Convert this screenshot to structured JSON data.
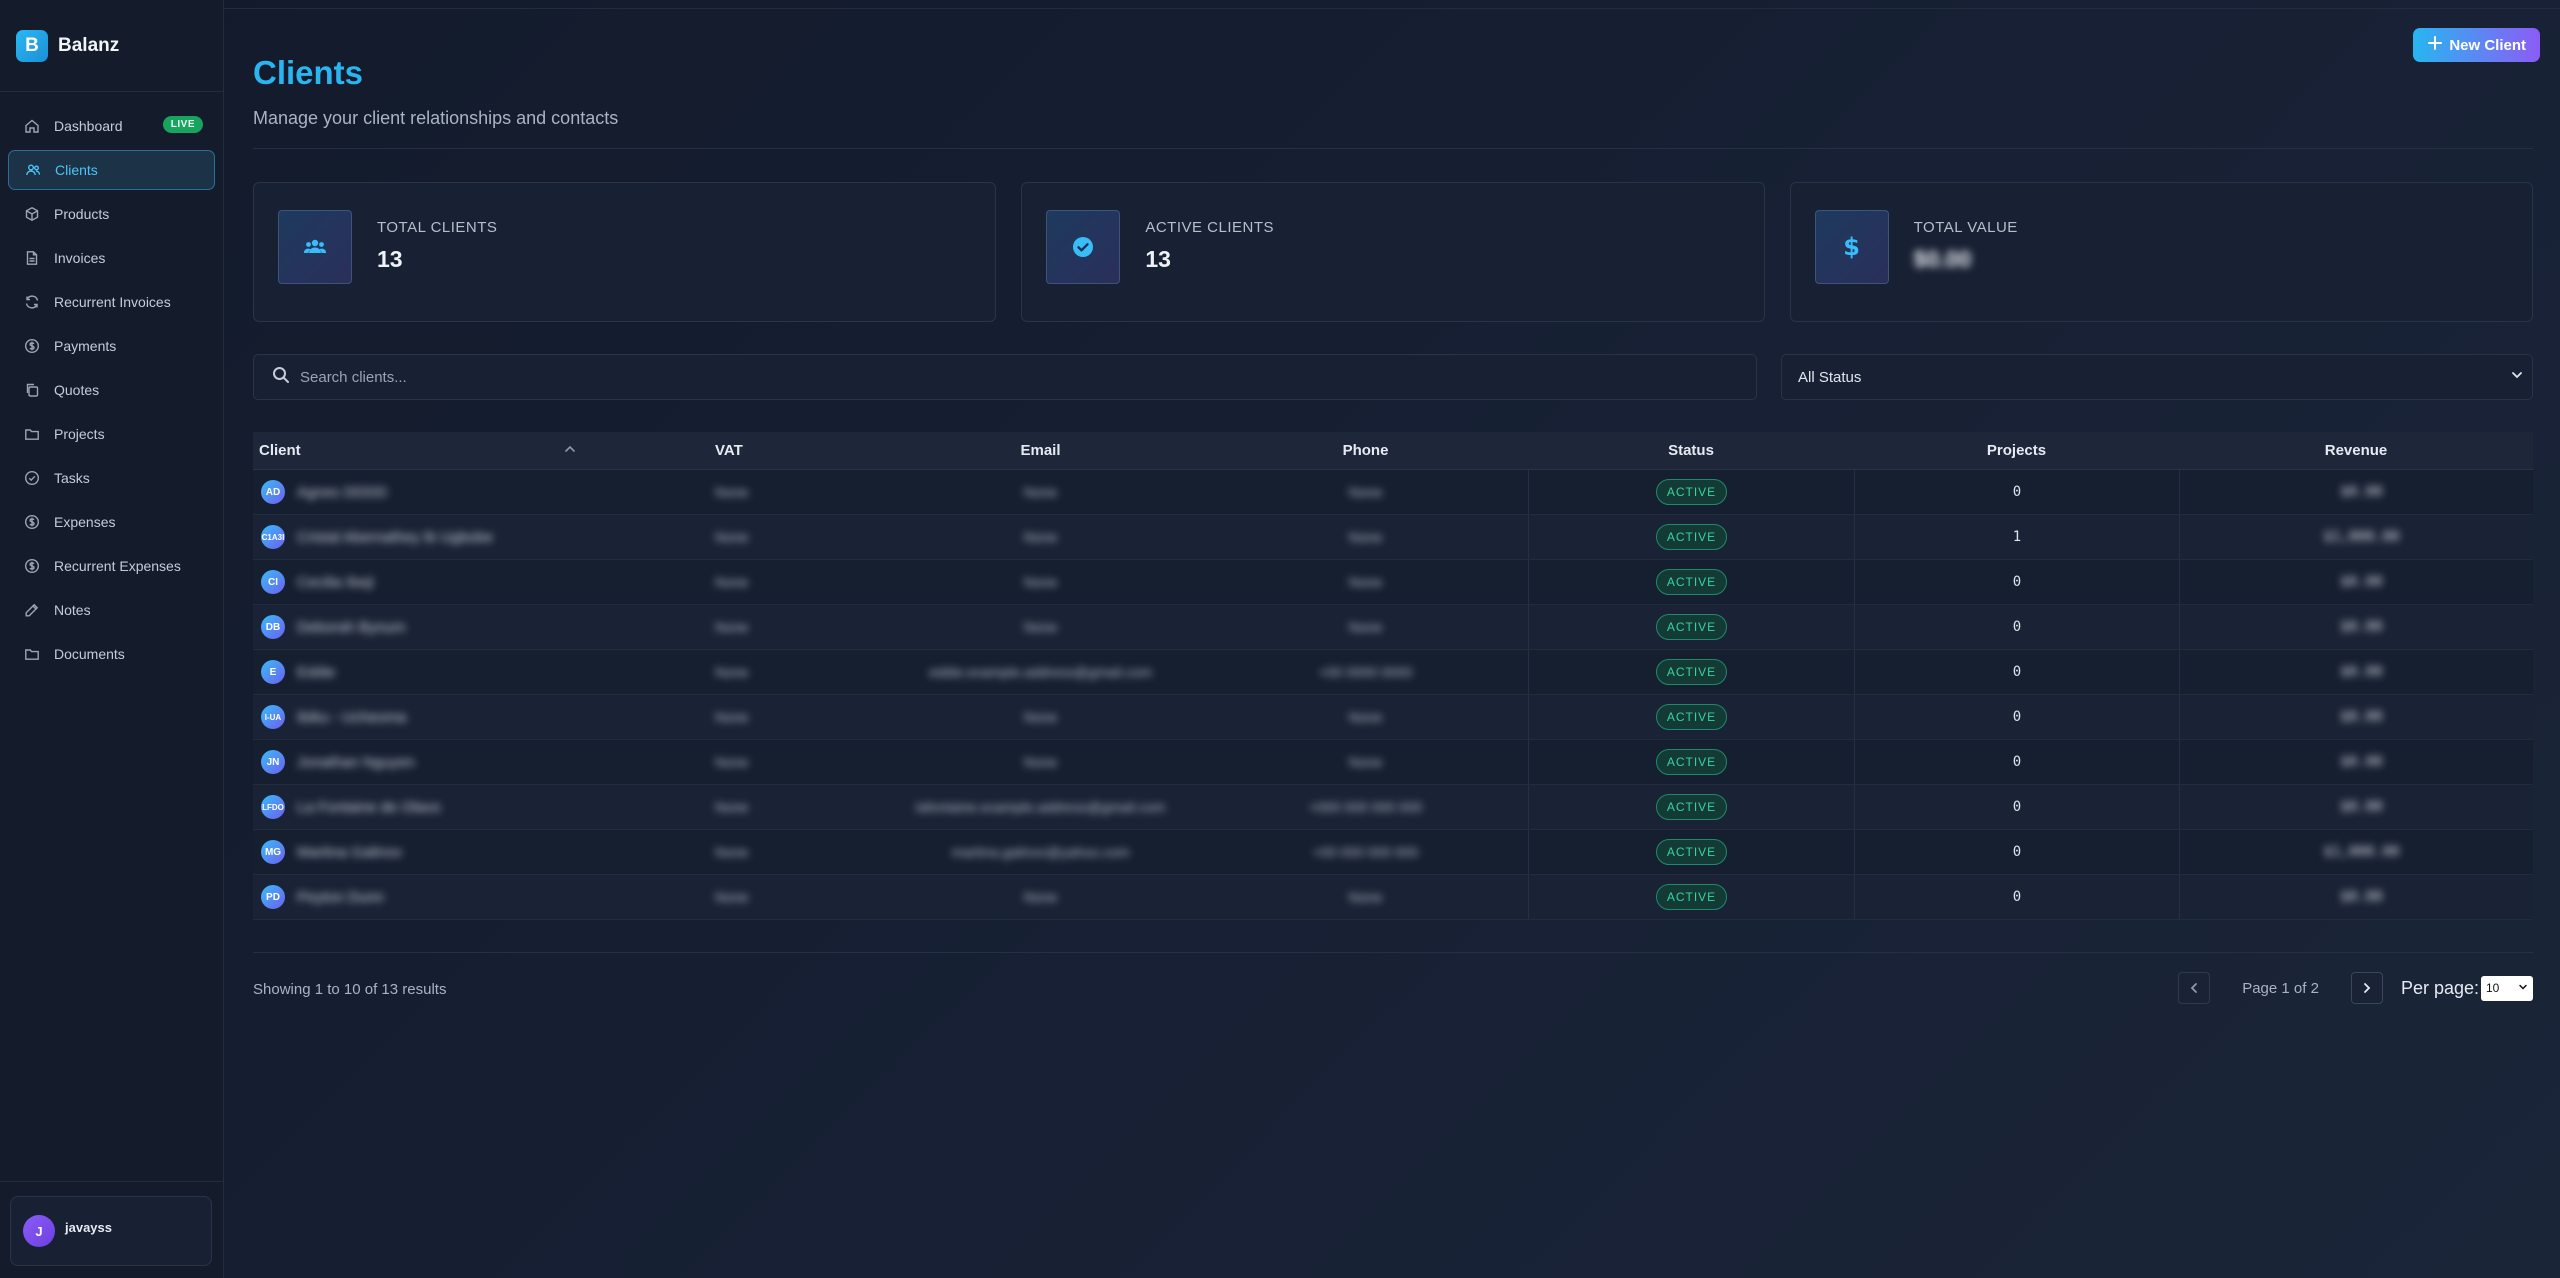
{
  "app": {
    "name": "Balanz",
    "logo_letter": "B"
  },
  "sidebar": {
    "items": [
      {
        "label": "Dashboard",
        "icon": "home-icon",
        "badge": "LIVE"
      },
      {
        "label": "Clients",
        "icon": "users-icon",
        "active": true
      },
      {
        "label": "Products",
        "icon": "box-icon"
      },
      {
        "label": "Invoices",
        "icon": "file-text-icon"
      },
      {
        "label": "Recurrent Invoices",
        "icon": "refresh-icon"
      },
      {
        "label": "Payments",
        "icon": "dollar-circle-icon"
      },
      {
        "label": "Quotes",
        "icon": "copy-icon"
      },
      {
        "label": "Projects",
        "icon": "folder-icon"
      },
      {
        "label": "Tasks",
        "icon": "check-circle-icon"
      },
      {
        "label": "Expenses",
        "icon": "dollar-circle-icon"
      },
      {
        "label": "Recurrent Expenses",
        "icon": "dollar-circle-icon"
      },
      {
        "label": "Notes",
        "icon": "edit-icon"
      },
      {
        "label": "Documents",
        "icon": "folder-icon"
      }
    ],
    "user": {
      "initial": "J",
      "name": "javayss"
    }
  },
  "header": {
    "title": "Clients",
    "subtitle": "Manage your client relationships and contacts",
    "new_button": "New Client"
  },
  "stats": [
    {
      "label": "TOTAL CLIENTS",
      "value": "13",
      "icon": "users-icon"
    },
    {
      "label": "ACTIVE CLIENTS",
      "value": "13",
      "icon": "check-circle-icon"
    },
    {
      "label": "TOTAL VALUE",
      "value": "$0.00",
      "icon": "dollar-icon"
    }
  ],
  "filters": {
    "search_placeholder": "Search clients...",
    "status_selected": "All Status"
  },
  "table": {
    "columns": [
      "Client",
      "VAT",
      "Email",
      "Phone",
      "Status",
      "Projects",
      "Revenue"
    ],
    "rows": [
      {
        "initials": "AD",
        "name": "Agnes DDDD",
        "vat": "None",
        "email": "None",
        "phone": "None",
        "status": "ACTIVE",
        "projects": "0",
        "revenue": "$0.00"
      },
      {
        "initials": "C1A3I",
        "name": "Cristal Abernathey Ib Ugbobe",
        "vat": "None",
        "email": "None",
        "phone": "None",
        "status": "ACTIVE",
        "projects": "1",
        "revenue": "$1,000.00"
      },
      {
        "initials": "CI",
        "name": "Cecilia Ibeji",
        "vat": "None",
        "email": "None",
        "phone": "None",
        "status": "ACTIVE",
        "projects": "0",
        "revenue": "$0.00"
      },
      {
        "initials": "DB",
        "name": "Deborah Bynum",
        "vat": "None",
        "email": "None",
        "phone": "None",
        "status": "ACTIVE",
        "projects": "0",
        "revenue": "$0.00"
      },
      {
        "initials": "E",
        "name": "Eddie",
        "vat": "None",
        "email": "eddie.example.address@gmail.com",
        "phone": "+00 0000 0000",
        "status": "ACTIVE",
        "projects": "0",
        "revenue": "$0.00"
      },
      {
        "initials": "I-UA",
        "name": "Ibiku - Ucheoma",
        "vat": "None",
        "email": "None",
        "phone": "None",
        "status": "ACTIVE",
        "projects": "0",
        "revenue": "$0.00"
      },
      {
        "initials": "JN",
        "name": "Jonathan Nguyen",
        "vat": "None",
        "email": "None",
        "phone": "None",
        "status": "ACTIVE",
        "projects": "0",
        "revenue": "$0.00"
      },
      {
        "initials": "LFDO",
        "name": "La Fontaine de Olavo",
        "vat": "None",
        "email": "lafontaine.example.address@gmail.com",
        "phone": "+000 000 000 000",
        "status": "ACTIVE",
        "projects": "0",
        "revenue": "$0.00"
      },
      {
        "initials": "MG",
        "name": "Martina Galinov",
        "vat": "None",
        "email": "martina.galinov@yahoo.com",
        "phone": "+00 000 000 000",
        "status": "ACTIVE",
        "projects": "0",
        "revenue": "$1,000.00"
      },
      {
        "initials": "PD",
        "name": "Peyton Dunn",
        "vat": "None",
        "email": "None",
        "phone": "None",
        "status": "ACTIVE",
        "projects": "0",
        "revenue": "$0.00"
      }
    ]
  },
  "pagination": {
    "showing": "Showing 1 to 10 of 13 results",
    "page_info": "Page 1 of 2",
    "per_page_label": "Per page:",
    "per_page_value": "10"
  }
}
